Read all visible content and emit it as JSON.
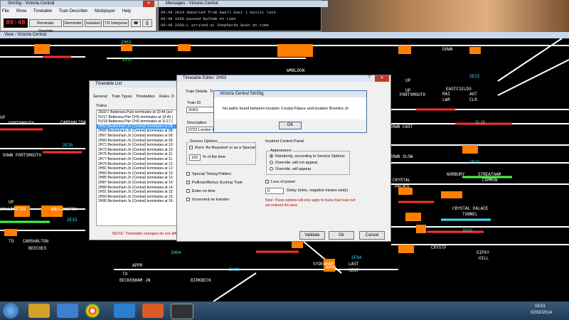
{
  "simsig": {
    "title": "SimSig - Victoria Central",
    "menu": [
      "File",
      "Show",
      "Timetable",
      "Train Describer",
      "Multiplayer",
      "Help"
    ],
    "clock": "09:48",
    "buttons": [
      "Reminder Override",
      "Reminder",
      "Isolation",
      "TD Interpose"
    ]
  },
  "messages": {
    "title": "Messages - Victoria Central",
    "lines": [
      "09:48 2K24 departed from Ewell East 1 min(s) late",
      "09:48 1H59 passed Balham on time",
      "09:48 2G59-L arrived at Shepherds Bush on time"
    ]
  },
  "view": {
    "title": "View - Victoria Central"
  },
  "map": {
    "labels": [
      {
        "t": "2H63",
        "c": "lbl-cyan"
      },
      {
        "t": "2V27",
        "c": "lbl-green"
      },
      {
        "t": "WMBLDON",
        "c": ""
      },
      {
        "t": "UP",
        "c": ""
      },
      {
        "t": "PORTSMOUTH",
        "c": ""
      },
      {
        "t": "CARSHALTON",
        "c": ""
      },
      {
        "t": "2E20",
        "c": "lbl-cyan"
      },
      {
        "t": "DOWN PORTSMOUTH",
        "c": ""
      },
      {
        "t": "UP",
        "c": ""
      },
      {
        "t": "WALLINGTON",
        "c": ""
      },
      {
        "t": "WALLINGTON",
        "c": ""
      },
      {
        "t": "2E33",
        "c": "lbl-cyan"
      },
      {
        "t": "TO",
        "c": ""
      },
      {
        "t": "CARSHALTON",
        "c": ""
      },
      {
        "t": "BEECHES",
        "c": ""
      },
      {
        "t": "APPR",
        "c": ""
      },
      {
        "t": "TO",
        "c": ""
      },
      {
        "t": "BECKENHAM JN",
        "c": ""
      },
      {
        "t": "2H03",
        "c": "lbl-cyan"
      },
      {
        "t": "BIRKBECK",
        "c": ""
      },
      {
        "t": "SYDENHAM",
        "c": ""
      },
      {
        "t": "LAST",
        "c": ""
      },
      {
        "t": "SENT",
        "c": ""
      },
      {
        "t": "APPR",
        "c": ""
      },
      {
        "t": "DOWN",
        "c": ""
      },
      {
        "t": "UP",
        "c": ""
      },
      {
        "t": "EASTFIELDS",
        "c": ""
      },
      {
        "t": "RAI",
        "c": ""
      },
      {
        "t": "AUT",
        "c": ""
      },
      {
        "t": "LWR",
        "c": ""
      },
      {
        "t": "CLR",
        "c": ""
      },
      {
        "t": "UP",
        "c": ""
      },
      {
        "t": "PORTSMOUTH",
        "c": ""
      },
      {
        "t": "2L15",
        "c": "lbl-cyan"
      },
      {
        "t": "NORBURY",
        "c": ""
      },
      {
        "t": "STREATHAM",
        "c": ""
      },
      {
        "t": "COMMON",
        "c": ""
      },
      {
        "t": "CRYSTAL",
        "c": ""
      },
      {
        "t": "PALACE",
        "c": ""
      },
      {
        "t": "CRYSTAL PALACE",
        "c": ""
      },
      {
        "t": "TUNNEL",
        "c": ""
      },
      {
        "t": "3S32",
        "c": "lbl-cyan"
      },
      {
        "t": "CRYSTP",
        "c": ""
      },
      {
        "t": "GIPSY",
        "c": ""
      },
      {
        "t": "HILL",
        "c": ""
      },
      {
        "t": "2E22",
        "c": "lbl-cyan"
      },
      {
        "t": "2E23",
        "c": "lbl-cyan"
      },
      {
        "t": "2H04",
        "c": "lbl-cyan"
      },
      {
        "t": "2F04",
        "c": "lbl-cyan"
      },
      {
        "t": "DOWN FAST",
        "c": ""
      },
      {
        "t": "DOWN SLOW",
        "c": ""
      }
    ]
  },
  "timetable_list": {
    "title": "Timetable List",
    "tabs": [
      "General",
      "Train Types",
      "Timetables",
      "Rules",
      "D"
    ],
    "column": "Trains",
    "rows": [
      "3S92:1 Battersea Park terminates at 10:44  (act",
      "5V/17 Battersea Pier CHS terminates at 10:45  (",
      "5V/18 Battersea Pier CHS terminates at 11:17  (",
      "2H63 Beckenham Jn (Central) terminates at 08:",
      "2H65 Beckenham Jn (Central) terminates at 08:",
      "2H67 Beckenham Jn (Central) terminates at 09:",
      "2H69 Beckenham Jn (Central) terminates at 09:",
      "2H71 Beckenham Jn (Central) terminates at 10:",
      "2H73 Beckenham Jn (Central) terminates at 10:",
      "2H75 Beckenham Jn (Central) terminates at 11:",
      "2H77 Beckenham Jn (Central) terminates at 11:",
      "2H79 Beckenham Jn (Central) terminates at 12:",
      "2H81 Beckenham Jn (Central) terminates at 12:",
      "2H83 Beckenham Jn (Central) terminates at 13:",
      "2H85 Beckenham Jn (Central) terminates at 13:",
      "2H87 Beckenham Jn (Central) terminates at 14:",
      "2H89 Beckenham Jn (Central) terminates at 14:",
      "2H91 Beckenham Jn (Central) terminates at 15:",
      "2H93 Beckenham Jn (Central) terminates at 15:",
      "2H95 Beckenham Jn (Central) terminates at 16:"
    ],
    "selected_index": 3,
    "note": "NOTE: Timetable changes do not affe"
  },
  "editor": {
    "title": "Timetable Editor: 2H63",
    "tabs": [
      "Train Details",
      "Ti"
    ],
    "train_id_label": "Train ID",
    "train_id": "2H63",
    "description_label": "Description",
    "description": "0722 London Br",
    "service_options": "Service Options",
    "runs_as_required": "Runs 'As Required' or as a Special",
    "percent": "100",
    "percent_suffix": "% of the time",
    "special_timing": "Special Timing Pattern",
    "pullman": "Pullman/Bonus Scoring Train",
    "enter_on_time": "Enter on time",
    "increment": "Increment on transfer",
    "incident_panel": "Incident Control Panel",
    "appearance": "Appearance",
    "radio1": "Randomly, according to Service Options",
    "radio2": "Override, will not appear",
    "radio3": "Override, will appear",
    "loss_of_power": "Loss of power",
    "delay_value": "0",
    "delay_label": "Delay (mins, negative means early)",
    "note": "Note: These options will only apply to trains that have not yet entered the area",
    "validate": "Validate",
    "ok": "Ok",
    "cancel": "Cancel"
  },
  "alert": {
    "title": "Victoria Central SimSig",
    "message": "No paths found between location Crystal Palace and location Bromley Jn",
    "ok": "OK"
  },
  "taskbar": {
    "time": "16:51",
    "date": "02/02/2014"
  }
}
